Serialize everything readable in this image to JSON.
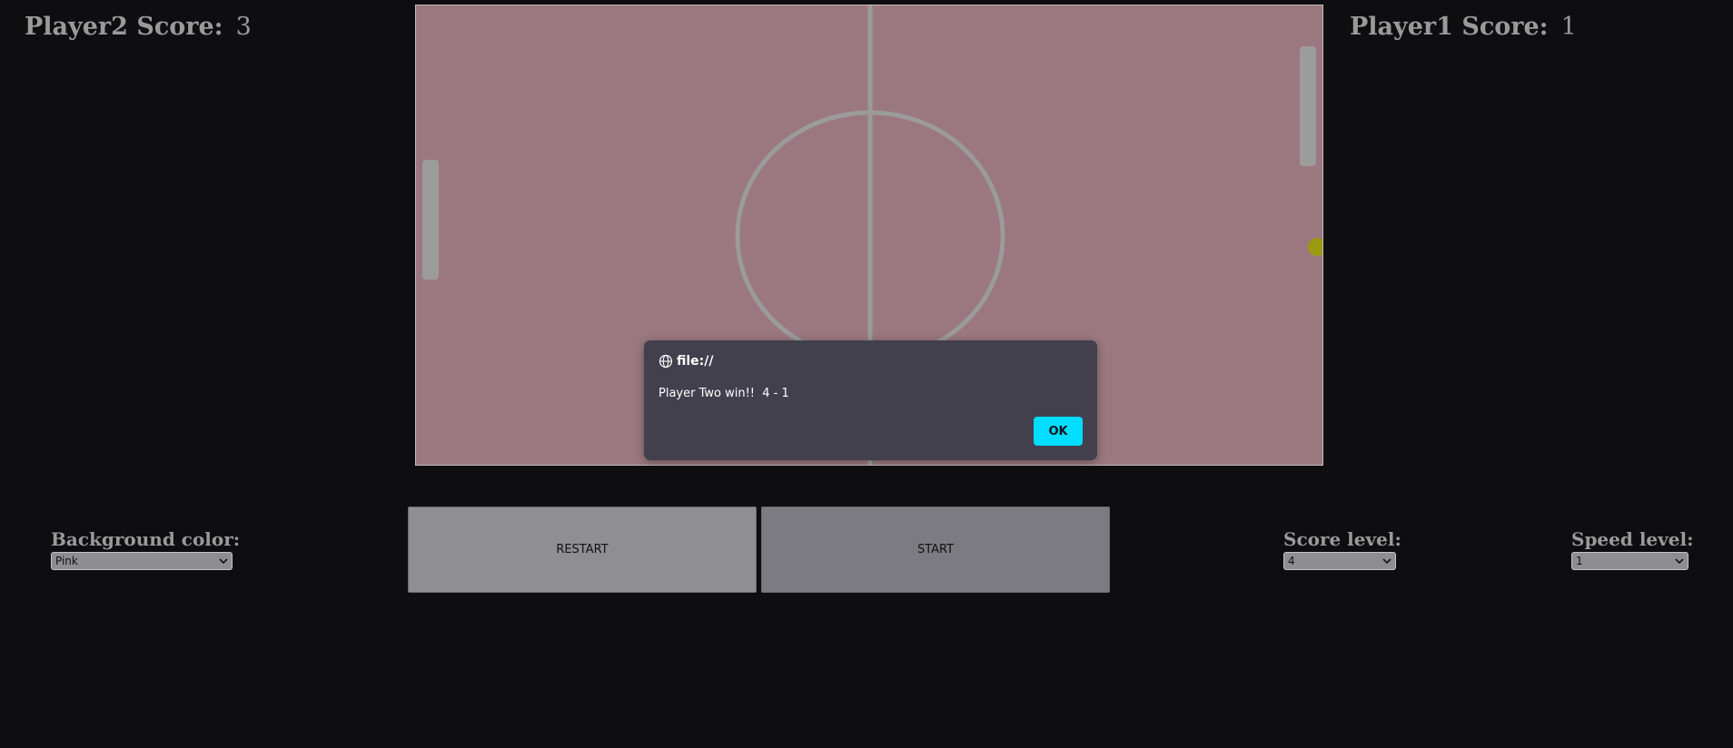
{
  "scores": {
    "left": {
      "label": "Player2 Score:",
      "value": "3"
    },
    "right": {
      "label": "Player1 Score:",
      "value": "1"
    }
  },
  "field": {
    "background": "#9b7880",
    "line_color": "#9b9b9b",
    "paddle_color": "#9c9c9c",
    "ball_color": "#9b9a10"
  },
  "dialog": {
    "origin": "file://",
    "message": "Player Two win!!  4 - 1",
    "ok_label": "OK",
    "icon": "globe-icon"
  },
  "controls": {
    "background": {
      "label": "Background color:",
      "value": "Pink"
    },
    "score_level": {
      "label": "Score level:",
      "value": "4"
    },
    "speed_level": {
      "label": "Speed level:",
      "value": "1"
    },
    "restart_label": "RESTART",
    "start_label": "START"
  }
}
